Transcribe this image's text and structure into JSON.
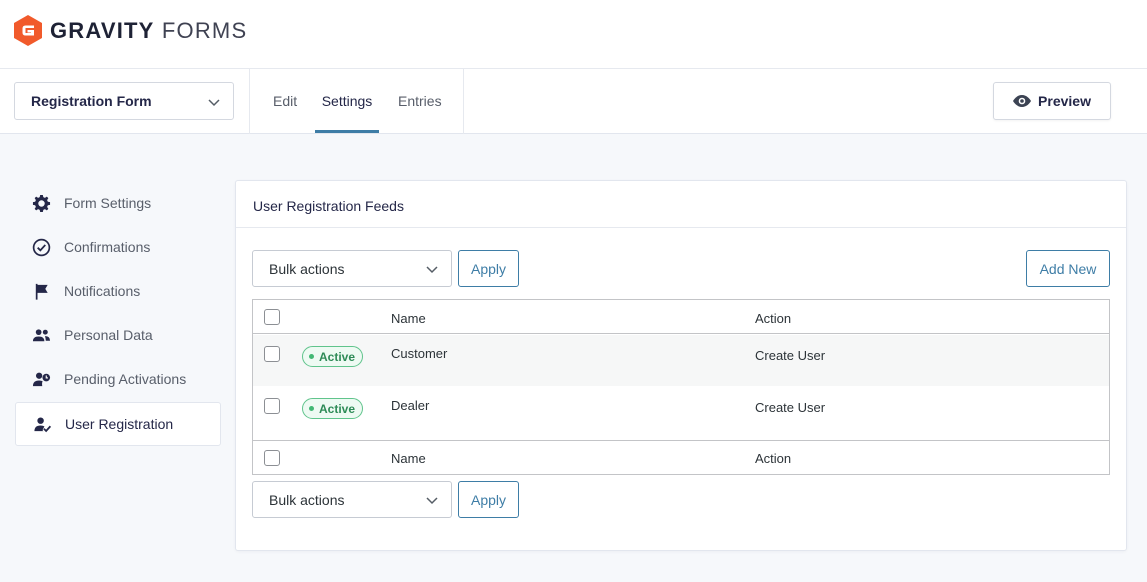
{
  "logo": {
    "word1": "GRAVITY",
    "word2": "FORMS"
  },
  "toolbar": {
    "form_selector": "Registration Form",
    "tabs": [
      {
        "label": "Edit"
      },
      {
        "label": "Settings"
      },
      {
        "label": "Entries"
      }
    ],
    "active_tab": "Settings",
    "preview_label": "Preview"
  },
  "sidebar": {
    "items": [
      {
        "label": "Form Settings",
        "icon": "gear-icon"
      },
      {
        "label": "Confirmations",
        "icon": "check-circle-icon"
      },
      {
        "label": "Notifications",
        "icon": "flag-icon"
      },
      {
        "label": "Personal Data",
        "icon": "users-icon"
      },
      {
        "label": "Pending Activations",
        "icon": "user-clock-icon"
      },
      {
        "label": "User Registration",
        "icon": "user-check-icon"
      }
    ],
    "active_item": "User Registration"
  },
  "panel": {
    "title": "User Registration Feeds",
    "bulk_actions_label": "Bulk actions",
    "apply_label": "Apply",
    "add_new_label": "Add New",
    "table": {
      "columns": {
        "name": "Name",
        "action": "Action"
      },
      "rows": [
        {
          "status": "Active",
          "name": "Customer",
          "action": "Create User"
        },
        {
          "status": "Active",
          "name": "Dealer",
          "action": "Create User"
        }
      ]
    }
  },
  "colors": {
    "brand_orange": "#f15a2b",
    "accent_blue": "#3e7da6",
    "active_green": "#2e8b57"
  }
}
